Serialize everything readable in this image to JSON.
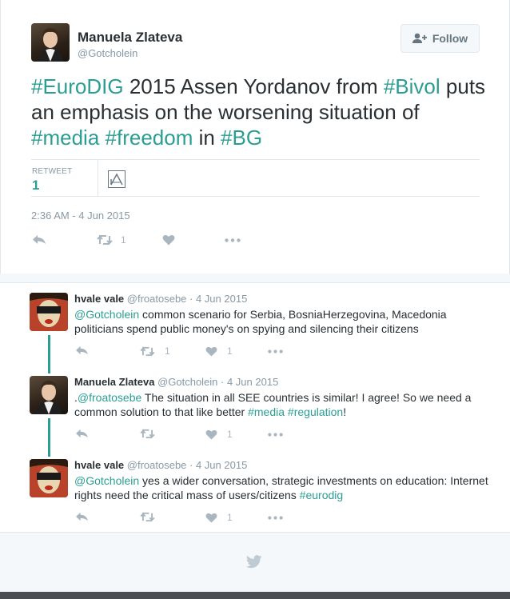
{
  "main_tweet": {
    "author_name": "Manuela Zlateva",
    "handle": "@Gotcholein",
    "follow_label": "Follow",
    "text_parts": [
      {
        "text": "#EuroDIG",
        "hashtag": true
      },
      {
        "text": " 2015 Assen Yordanov from ",
        "hashtag": false
      },
      {
        "text": "#Bivol",
        "hashtag": true
      },
      {
        "text": " puts an emphasis on the worsening situation of ",
        "hashtag": false
      },
      {
        "text": "#media",
        "hashtag": true
      },
      {
        "text": " ",
        "hashtag": false
      },
      {
        "text": "#freedom",
        "hashtag": true
      },
      {
        "text": " in ",
        "hashtag": false
      },
      {
        "text": "#BG",
        "hashtag": true
      }
    ],
    "stat_label": "RETWEET",
    "stat_value": "1",
    "timestamp": "2:36 AM - 4 Jun 2015",
    "retweet_count": "1"
  },
  "replies": [
    {
      "name": "hvale vale",
      "meta": "@froatosebe · 4 Jun 2015",
      "text_parts": [
        {
          "text": "@Gotcholein",
          "hashtag": true
        },
        {
          "text": " common scenario for Serbia, BosniaHerzegovina, Macedonia politicians spend public money's on spying and silencing their citizens",
          "hashtag": false
        }
      ],
      "retweet_count": "1",
      "like_count": "1"
    },
    {
      "name": "Manuela Zlateva",
      "meta": "@Gotcholein · 4 Jun 2015",
      "text_parts": [
        {
          "text": ".",
          "hashtag": false
        },
        {
          "text": "@froatosebe",
          "hashtag": true
        },
        {
          "text": " The situation in all SEE countries is similar! I agree! So we need a common solution to that like better ",
          "hashtag": false
        },
        {
          "text": "#media",
          "hashtag": true
        },
        {
          "text": " ",
          "hashtag": false
        },
        {
          "text": "#regulation",
          "hashtag": true
        },
        {
          "text": "!",
          "hashtag": false
        }
      ],
      "retweet_count": "",
      "like_count": "1"
    },
    {
      "name": "hvale vale",
      "meta": "@froatosebe · 4 Jun 2015",
      "text_parts": [
        {
          "text": "@Gotcholein",
          "hashtag": true
        },
        {
          "text": " yes a wider conversation, strategic investments on education: Internet rights need the critical mass of users/citizens ",
          "hashtag": false
        },
        {
          "text": "#eurodig",
          "hashtag": true
        }
      ],
      "retweet_count": "",
      "like_count": "1"
    }
  ],
  "colors": {
    "link": "#2b9e94",
    "text": "#292f33",
    "muted": "#8899a6",
    "icon": "#a9b5bf"
  }
}
